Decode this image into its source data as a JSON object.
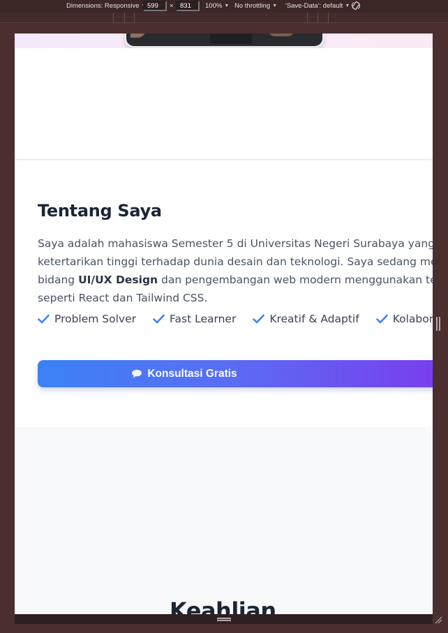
{
  "devtools": {
    "dimensions_label": "Dimensions: Responsive",
    "width_value": "599",
    "times": "×",
    "height_value": "831",
    "zoom": "100%",
    "throttling": "No throttling",
    "save_data": "'Save-Data': default"
  },
  "about": {
    "title": "Tentang Saya",
    "line1": "Saya adalah mahasiswa Semester 5 di Universitas Negeri Surabaya yang memiliki",
    "line2": "ketertarikan tinggi terhadap dunia desain dan teknologi. Saya sedang mendalami",
    "line3_before": "bidang ",
    "line3_strong": "UI/UX Design",
    "line3_after": " dan pengembangan web modern menggunakan teknologi",
    "line4": "seperti React dan Tailwind CSS.",
    "traits": [
      "Problem Solver",
      "Fast Learner",
      "Kreatif & Adaptif",
      "Kolaboratif"
    ],
    "cta_label": "Konsultasi Gratis"
  },
  "skills": {
    "title": "Keahlian"
  },
  "colors": {
    "accent_blue": "#3b82f6",
    "accent_purple": "#7c3aed",
    "heading": "#1b2536"
  },
  "icons": [
    "chevron-down-icon",
    "rotate-icon",
    "check-icon",
    "chat-bubble-icon",
    "resize-grip-icon"
  ]
}
